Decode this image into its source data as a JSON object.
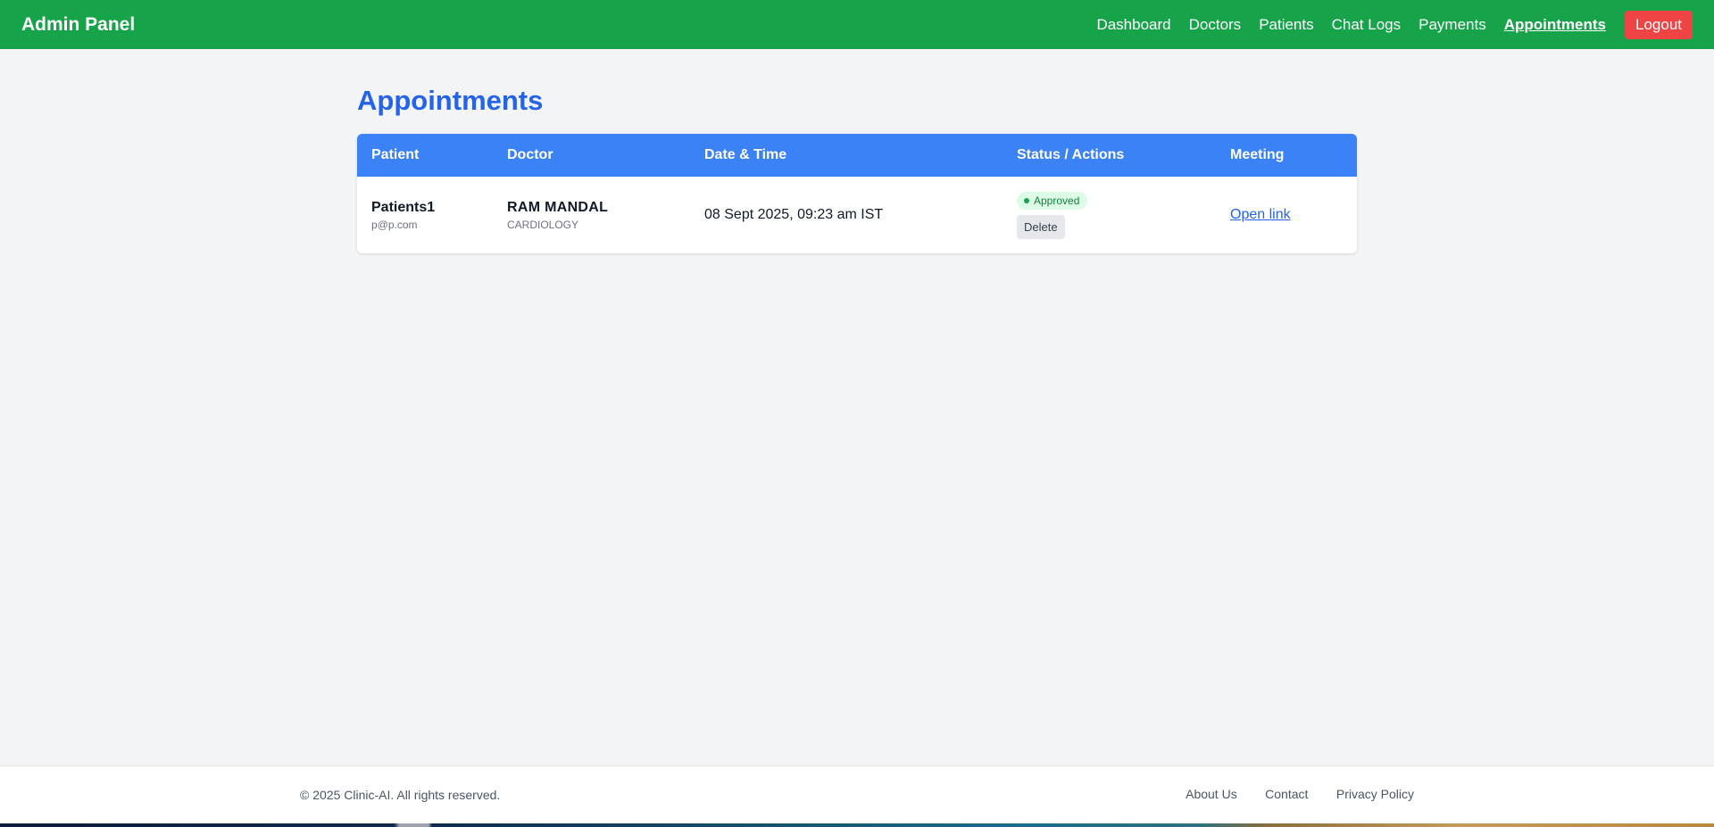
{
  "header": {
    "brand": "Admin Panel",
    "nav": {
      "dashboard": "Dashboard",
      "doctors": "Doctors",
      "patients": "Patients",
      "chat_logs": "Chat Logs",
      "payments": "Payments",
      "appointments": "Appointments"
    },
    "logout": "Logout"
  },
  "main": {
    "title": "Appointments",
    "table": {
      "columns": {
        "patient": "Patient",
        "doctor": "Doctor",
        "date_time": "Date & Time",
        "status_actions": "Status / Actions",
        "meeting": "Meeting"
      },
      "rows": [
        {
          "patient_name": "Patients1",
          "patient_email": "p@p.com",
          "doctor_name": "RAM MANDAL",
          "doctor_specialty": "CARDIOLOGY",
          "date_time": "08 Sept 2025, 09:23 am IST",
          "status": "Approved",
          "delete_label": "Delete",
          "meeting_label": "Open link"
        }
      ]
    }
  },
  "footer": {
    "copyright": "© 2025 Clinic-AI. All rights reserved.",
    "links": {
      "about": "About Us",
      "contact": "Contact",
      "privacy": "Privacy Policy"
    }
  },
  "colors": {
    "header_bg": "#16a34a",
    "title": "#2563eb",
    "table_header_bg": "#3b82f6",
    "logout_bg": "#ef4444",
    "status_badge_bg": "#dcfce7",
    "status_badge_text": "#15803d",
    "link": "#2563eb"
  },
  "icons": {
    "status": "status-dot-icon"
  }
}
